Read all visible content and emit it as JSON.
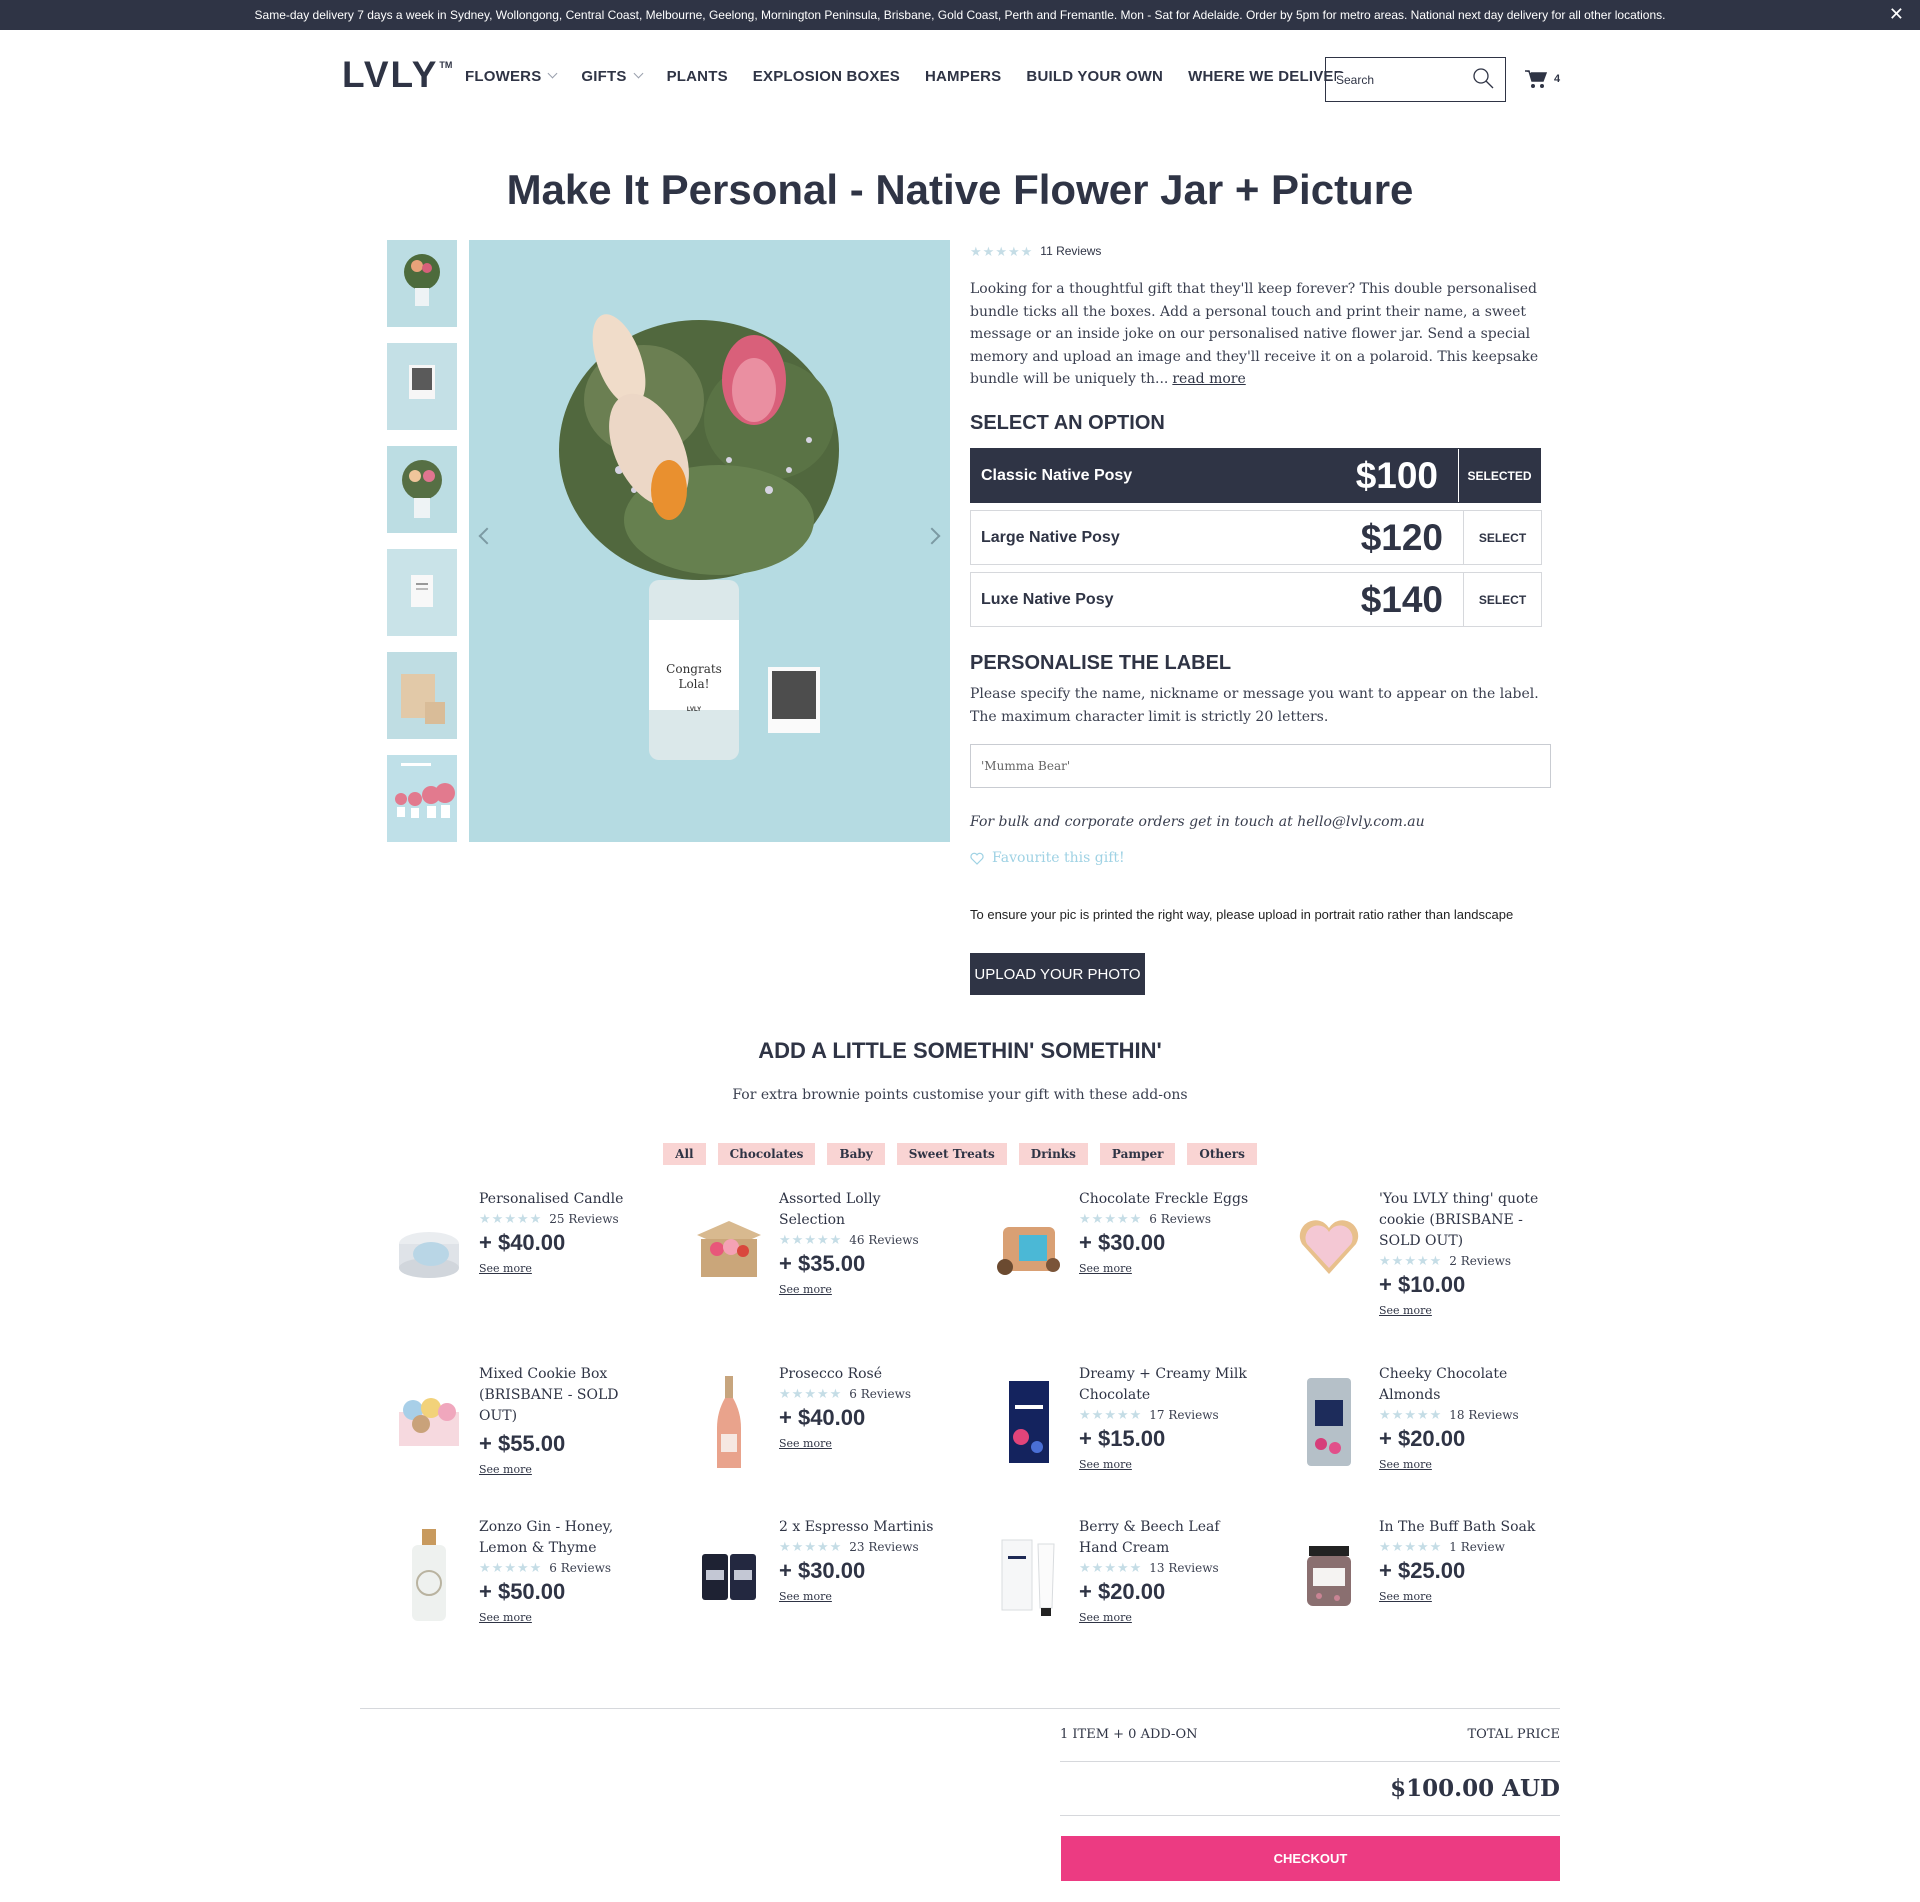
{
  "announcement": {
    "text": "Same-day delivery 7 days a week in Sydney, Wollongong, Central Coast, Melbourne, Geelong, Mornington Peninsula, Brisbane, Gold Coast, Perth and Fremantle. Mon - Sat for Adelaide. Order by 5pm for metro areas. National next day delivery for all other locations.",
    "close": "✕"
  },
  "header": {
    "logo": "LVLY",
    "logo_tm": "TM",
    "nav": [
      "FLOWERS",
      "GIFTS",
      "PLANTS",
      "EXPLOSION BOXES",
      "HAMPERS",
      "BUILD YOUR OWN",
      "WHERE WE DELIVER"
    ],
    "search_placeholder": "Search",
    "cart_count": "4"
  },
  "product": {
    "title": "Make It Personal - Native Flower Jar + Picture",
    "reviews": "11 Reviews",
    "description": "Looking for a thoughtful gift that they'll keep forever? This double personalised bundle ticks all the boxes. Add a personal touch and print their name, a sweet message or an inside joke on our personalised native flower jar. Send a special memory and upload an image and they'll receive it on a polaroid. This keepsake bundle will be uniquely th...",
    "read_more": "read more",
    "jar_label_line1": "Congrats",
    "jar_label_line2": "Lola!",
    "jar_brand": "LVLY"
  },
  "options": {
    "heading": "SELECT AN OPTION",
    "items": [
      {
        "name": "Classic Native Posy",
        "price": "$100",
        "action": "SELECTED"
      },
      {
        "name": "Large Native Posy",
        "price": "$120",
        "action": "SELECT"
      },
      {
        "name": "Luxe Native Posy",
        "price": "$140",
        "action": "SELECT"
      }
    ]
  },
  "personalise": {
    "heading": "PERSONALISE THE LABEL",
    "help": "Please specify the name, nickname or message you want to appear on the label. The maximum character limit is strictly 20 letters.",
    "placeholder": "'Mumma Bear'",
    "bulk": "For bulk and corporate orders get in touch at hello@lvly.com.au",
    "favourite": "Favourite this gift!",
    "upload_note": "To ensure your pic is printed the right way, please upload in portrait ratio rather than landscape",
    "upload_button": "UPLOAD YOUR PHOTO"
  },
  "addons": {
    "heading": "ADD A LITTLE SOMETHIN' SOMETHIN'",
    "subheading": "For extra brownie points customise your gift with these add-ons",
    "filters": [
      "All",
      "Chocolates",
      "Baby",
      "Sweet Treats",
      "Drinks",
      "Pamper",
      "Others"
    ],
    "see_more": "See more",
    "items": [
      {
        "name": "Personalised Candle",
        "reviews": "25 Reviews",
        "price": "+ $40.00"
      },
      {
        "name": "Assorted Lolly Selection",
        "reviews": "46 Reviews",
        "price": "+ $35.00"
      },
      {
        "name": "Chocolate Freckle Eggs",
        "reviews": "6 Reviews",
        "price": "+ $30.00"
      },
      {
        "name": "'You LVLY thing' quote cookie (BRISBANE - SOLD OUT)",
        "reviews": "2 Reviews",
        "price": "+ $10.00"
      },
      {
        "name": "Mixed Cookie Box (BRISBANE - SOLD OUT)",
        "reviews": "",
        "price": "+ $55.00"
      },
      {
        "name": "Prosecco Rosé",
        "reviews": "6 Reviews",
        "price": "+ $40.00"
      },
      {
        "name": "Dreamy + Creamy Milk Chocolate",
        "reviews": "17 Reviews",
        "price": "+ $15.00"
      },
      {
        "name": "Cheeky Chocolate Almonds",
        "reviews": "18 Reviews",
        "price": "+ $20.00"
      },
      {
        "name": "Zonzo Gin - Honey, Lemon & Thyme",
        "reviews": "6 Reviews",
        "price": "+ $50.00"
      },
      {
        "name": "2 x Espresso Martinis",
        "reviews": "23 Reviews",
        "price": "+ $30.00"
      },
      {
        "name": "Berry & Beech Leaf Hand Cream",
        "reviews": "13 Reviews",
        "price": "+ $20.00"
      },
      {
        "name": "In The Buff Bath Soak",
        "reviews": "1 Review",
        "price": "+ $25.00"
      }
    ]
  },
  "summary": {
    "items_label": "1 ITEM + 0 ADD-ON",
    "total_label": "TOTAL PRICE",
    "total": "$100.00 AUD",
    "checkout": "CHECKOUT"
  },
  "colors": {
    "navy": "#2f3445",
    "pink_button": "#ec3b82",
    "filter_pink": "#f9d4d3",
    "favourite_blue": "#9fd2e4",
    "star_blue": "#c5dde6",
    "product_bg": "#b5dbe2"
  }
}
